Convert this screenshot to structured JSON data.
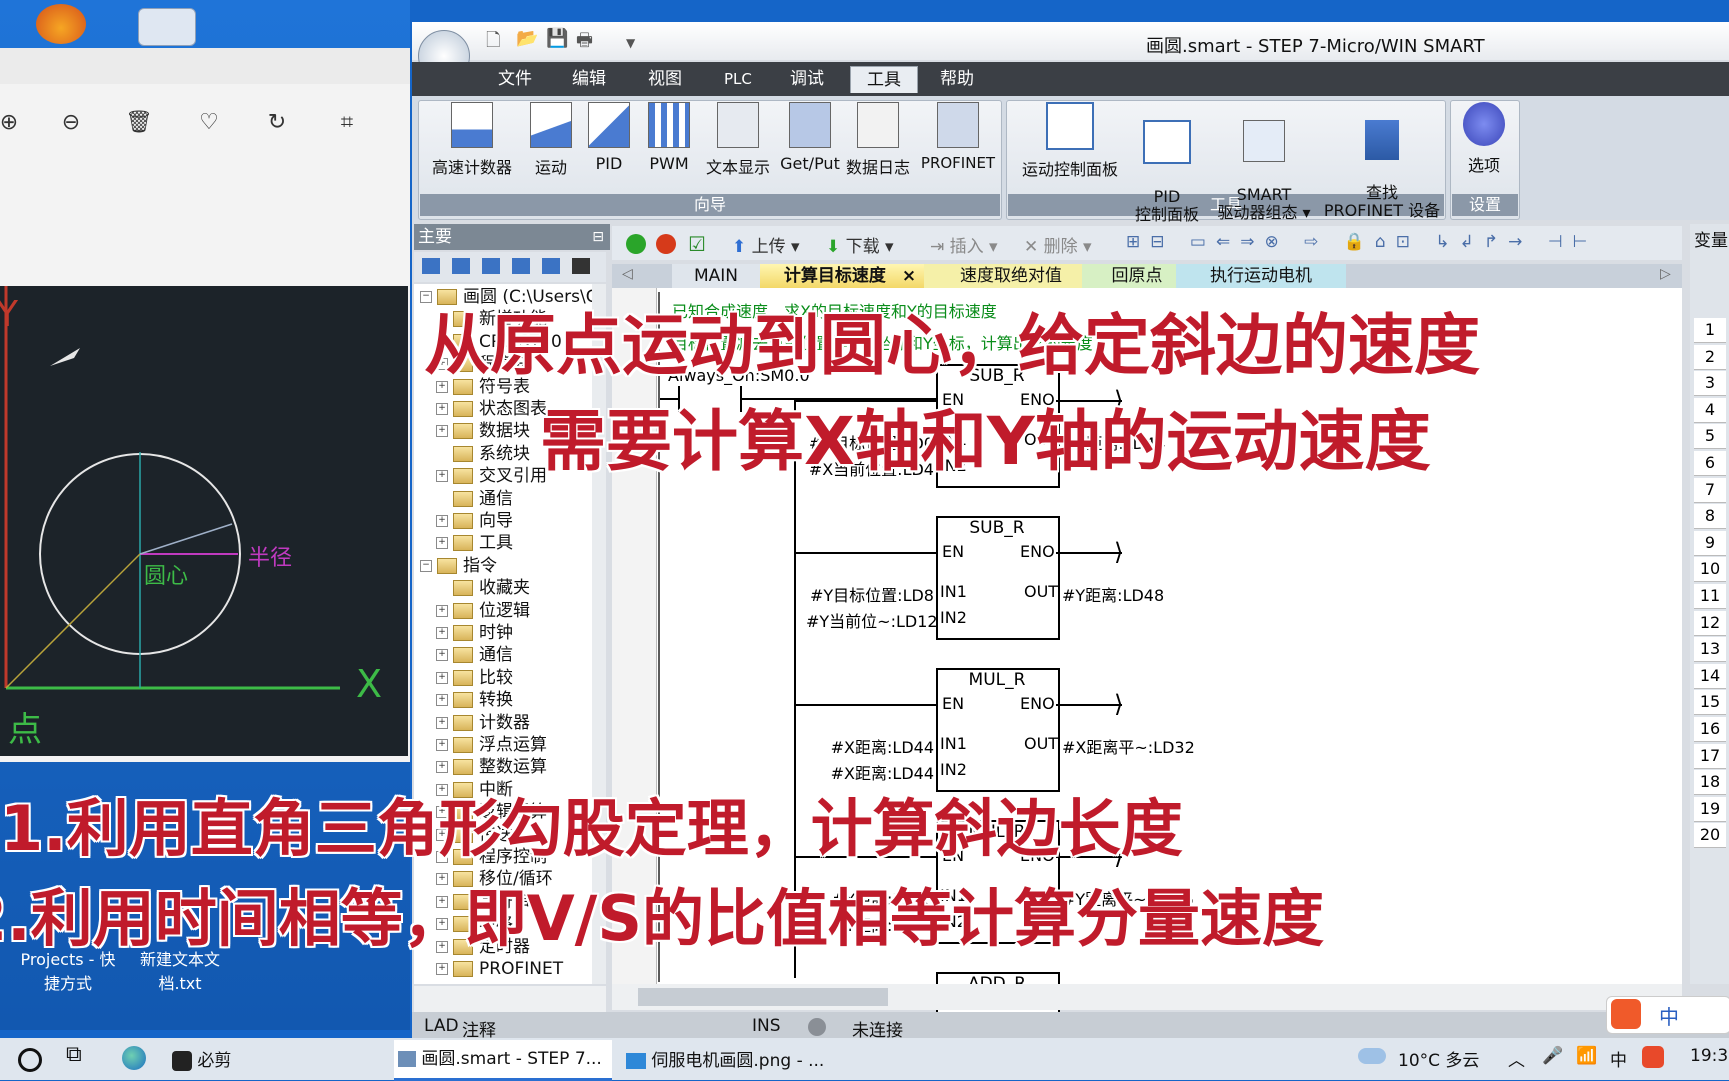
{
  "desktop": {
    "icons": [
      "media-player",
      "text-file"
    ],
    "items": [
      {
        "label": "Projects - 快\n捷方式"
      },
      {
        "label": "新建文本文\n档.txt"
      }
    ]
  },
  "viewer": {
    "tools": [
      "zoom-in-icon",
      "zoom-out-icon",
      "delete-icon",
      "favorite-icon",
      "rotate-icon",
      "crop-icon"
    ],
    "cad": {
      "axis_x": "X",
      "axis_y": "Y",
      "center_label": "圆心",
      "radius_label": "半径",
      "origin_label": "点"
    }
  },
  "window": {
    "title": "画圆.smart - STEP 7-Micro/WIN SMART",
    "menu": [
      "文件",
      "编辑",
      "视图",
      "PLC",
      "调试",
      "工具",
      "帮助"
    ],
    "active_menu": "工具",
    "ribbon": {
      "wizard_buttons": [
        "高速计数器",
        "运动",
        "PID",
        "PWM",
        "文本显示",
        "Get/Put",
        "数据日志",
        "PROFINET"
      ],
      "wizard_caption": "向导",
      "tool_buttons": [
        "运动控制面板",
        "PID\n控制面板",
        "SMART\n驱动器组态 ▾",
        "查找\nPROFINET 设备"
      ],
      "tool_caption": "工具",
      "settings_buttons": [
        "选项"
      ],
      "settings_caption": "设置"
    },
    "panel": {
      "header": "主要",
      "pin": "ᵠ",
      "tree": [
        {
          "label": "画圆 (C:\\Users\\C",
          "level": 0,
          "pm": "−"
        },
        {
          "label": "新增功能",
          "level": 1,
          "pm": ""
        },
        {
          "label": "CPU ST30",
          "level": 1,
          "pm": ""
        },
        {
          "label": "程序块",
          "level": 1,
          "pm": "+"
        },
        {
          "label": "符号表",
          "level": 1,
          "pm": "+"
        },
        {
          "label": "状态图表",
          "level": 1,
          "pm": "+"
        },
        {
          "label": "数据块",
          "level": 1,
          "pm": "+"
        },
        {
          "label": "系统块",
          "level": 1,
          "pm": ""
        },
        {
          "label": "交叉引用",
          "level": 1,
          "pm": "+"
        },
        {
          "label": "通信",
          "level": 1,
          "pm": ""
        },
        {
          "label": "向导",
          "level": 1,
          "pm": "+"
        },
        {
          "label": "工具",
          "level": 1,
          "pm": "+"
        },
        {
          "label": "指令",
          "level": 0,
          "pm": "−"
        },
        {
          "label": "收藏夹",
          "level": 1,
          "pm": ""
        },
        {
          "label": "位逻辑",
          "level": 1,
          "pm": "+"
        },
        {
          "label": "时钟",
          "level": 1,
          "pm": "+"
        },
        {
          "label": "通信",
          "level": 1,
          "pm": "+"
        },
        {
          "label": "比较",
          "level": 1,
          "pm": "+"
        },
        {
          "label": "转换",
          "level": 1,
          "pm": "+"
        },
        {
          "label": "计数器",
          "level": 1,
          "pm": "+"
        },
        {
          "label": "浮点运算",
          "level": 1,
          "pm": "+"
        },
        {
          "label": "整数运算",
          "level": 1,
          "pm": "+"
        },
        {
          "label": "中断",
          "level": 1,
          "pm": "+"
        },
        {
          "label": "逻辑运算",
          "level": 1,
          "pm": "+"
        },
        {
          "label": "传送",
          "level": 1,
          "pm": "+"
        },
        {
          "label": "程序控制",
          "level": 1,
          "pm": "+"
        },
        {
          "label": "移位/循环",
          "level": 1,
          "pm": "+"
        },
        {
          "label": "字符串",
          "level": 1,
          "pm": "+"
        },
        {
          "label": "表格",
          "level": 1,
          "pm": "+"
        },
        {
          "label": "定时器",
          "level": 1,
          "pm": "+"
        },
        {
          "label": "PROFINET",
          "level": 1,
          "pm": "+"
        }
      ]
    },
    "editor_toolbar": {
      "upload": "上传",
      "download": "下载",
      "insert": "插入",
      "delete": "删除"
    },
    "tabs": [
      {
        "label": "MAIN",
        "active": false
      },
      {
        "label": "计算目标速度",
        "active": true
      },
      {
        "label": "速度取绝对值",
        "active": false
      },
      {
        "label": "回原点",
        "active": false
      },
      {
        "label": "执行运动电机",
        "active": false
      }
    ],
    "ladder": {
      "comment1": "已知合成速度，求X的目标速度和Y的目标速度",
      "comment2": "目标位置减去当前位置等于X坐标和Y坐标，计算出它的长度",
      "contact": "Always_On:SM0.0",
      "blocks": [
        {
          "name": "SUB_R",
          "in1": "#X目标位置:LD0",
          "in2": "#X当前位置:LD4",
          "out": "#X距离:LD44"
        },
        {
          "name": "SUB_R",
          "in1": "#Y目标位置:LD8",
          "in2": "#Y当前位~:LD12",
          "out": "#Y距离:LD48"
        },
        {
          "name": "MUL_R",
          "in1": "#X距离:LD44",
          "in2": "#X距离:LD44",
          "out": "#X距离平~:LD32"
        },
        {
          "name": "MUL_R",
          "in1": "#Y距离:LD48",
          "in2": "#Y距离:LD48",
          "out": "#Y距离平~:LD36"
        },
        {
          "name": "ADD_R",
          "in1": "",
          "in2": "",
          "out": ""
        }
      ],
      "pins": {
        "en": "EN",
        "eno": "ENO",
        "in1": "IN1",
        "in2": "IN2",
        "out": "OUT"
      }
    },
    "var_panel": {
      "header": "变量",
      "rows": [
        "1",
        "2",
        "3",
        "4",
        "5",
        "6",
        "7",
        "8",
        "9",
        "10",
        "11",
        "12",
        "13",
        "14",
        "15",
        "16",
        "17",
        "18",
        "19",
        "20"
      ]
    },
    "status": {
      "mode": "LAD",
      "comment": "注释",
      "ins": "INS",
      "connection": "未连接"
    }
  },
  "overlay": {
    "line1": "从原点运动到圆心，给定斜边的速度",
    "line2_a": "需要计算",
    "line2_x": "X",
    "line2_b": "轴和",
    "line2_y": "Y",
    "line2_c": "轴的运动速度",
    "line3": "1.利用直角三角形勾股定理，计算斜边长度",
    "line4_a": "2.利用时间相等，即",
    "line4_vs": "V/S",
    "line4_b": "的比值相等计算分量速度"
  },
  "taskbar": {
    "apps": [
      {
        "label": "必剪"
      },
      {
        "label": "画圆.smart - STEP 7..."
      },
      {
        "label": "伺服电机画圆.png - ..."
      }
    ],
    "weather": "10°C 多云",
    "ime": "中",
    "time": "19:3"
  },
  "colors": {
    "caption_red": "#c01b2b",
    "cad_bg": "#1c2329",
    "menubar": "#3b3f45"
  }
}
